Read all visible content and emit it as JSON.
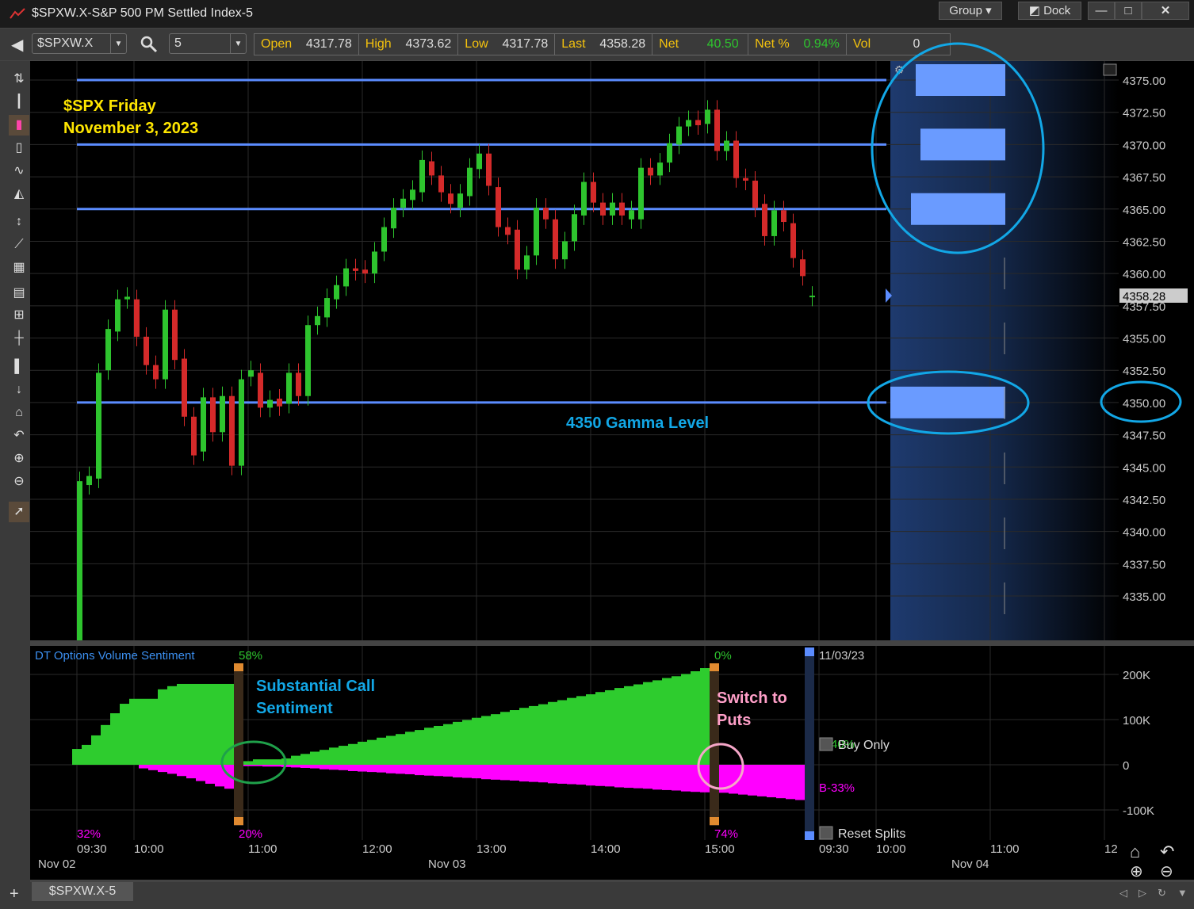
{
  "window": {
    "title": "$SPXW.X-S&P 500 PM Settled Index-5",
    "group_label": "Group",
    "dock_label": "Dock"
  },
  "toolbar": {
    "symbol": "$SPXW.X",
    "interval": "5",
    "stats": [
      {
        "label": "Open",
        "value": "4317.78"
      },
      {
        "label": "High",
        "value": "4373.62"
      },
      {
        "label": "Low",
        "value": "4317.78"
      },
      {
        "label": "Last",
        "value": "4358.28"
      },
      {
        "label": "Net",
        "value": "40.50"
      },
      {
        "label": "Net %",
        "value": "0.94%"
      },
      {
        "label": "Vol",
        "value": "0"
      }
    ]
  },
  "colors": {
    "up": "#2ec42e",
    "down": "#d42a2a",
    "level_line": "#5b8cff",
    "annotation_cyan": "#12a7e6",
    "annotation_yellow": "#ffe600",
    "annotation_pink": "#ff9fc8",
    "calls": "#2ecc2e",
    "puts": "#ff00ff"
  },
  "annotations": {
    "title1": "$SPX Friday",
    "title2": "November 3, 2023",
    "gamma": "4350 Gamma Level",
    "call1": "Substantial Call",
    "call2": "Sentiment",
    "put1": "Switch to",
    "put2": "Puts"
  },
  "chart_data": [
    {
      "type": "candlestick",
      "title": "",
      "price_ticks": [
        "4375.00",
        "4372.50",
        "4370.00",
        "4367.50",
        "4365.00",
        "4362.50",
        "4360.00",
        "4357.50",
        "4355.00",
        "4352.50",
        "4350.00",
        "4347.50",
        "4345.00",
        "4342.50",
        "4340.00",
        "4337.50",
        "4335.00"
      ],
      "ylim": [
        4332.5,
        4376.5
      ],
      "last_price": "4358.28",
      "interval_minutes": 5,
      "start_time": "09:30",
      "levels": [
        4375,
        4370,
        4365,
        4350
      ],
      "candles_open_close": [
        [
          4317.78,
          4343.9
        ],
        [
          4343.6,
          4344.3
        ],
        [
          4344.1,
          4352.3
        ],
        [
          4352.5,
          4355.7
        ],
        [
          4355.5,
          4358.0
        ],
        [
          4358.0,
          4358.2
        ],
        [
          4358.0,
          4355.1
        ],
        [
          4355.1,
          4352.9
        ],
        [
          4352.9,
          4351.8
        ],
        [
          4351.8,
          4357.2
        ],
        [
          4357.2,
          4353.3
        ],
        [
          4353.4,
          4348.9
        ],
        [
          4348.9,
          4345.9
        ],
        [
          4346.2,
          4350.4
        ],
        [
          4350.4,
          4347.7
        ],
        [
          4347.7,
          4350.5
        ],
        [
          4350.5,
          4345.1
        ],
        [
          4345.1,
          4351.8
        ],
        [
          4352.0,
          4352.5
        ],
        [
          4352.3,
          4349.6
        ],
        [
          4349.6,
          4350.2
        ],
        [
          4350.3,
          4349.7
        ],
        [
          4349.9,
          4352.3
        ],
        [
          4352.3,
          4350.5
        ],
        [
          4350.5,
          4356.0
        ],
        [
          4356.0,
          4356.7
        ],
        [
          4356.6,
          4358.1
        ],
        [
          4358.0,
          4359.1
        ],
        [
          4359.0,
          4360.4
        ],
        [
          4360.4,
          4360.2
        ],
        [
          4360.3,
          4360.0
        ],
        [
          4360.0,
          4361.7
        ],
        [
          4361.7,
          4363.6
        ],
        [
          4363.5,
          4365.1
        ],
        [
          4365.1,
          4365.8
        ],
        [
          4365.7,
          4366.5
        ],
        [
          4366.3,
          4368.8
        ],
        [
          4368.7,
          4367.6
        ],
        [
          4367.6,
          4366.3
        ],
        [
          4366.2,
          4365.4
        ],
        [
          4365.1,
          4366.2
        ],
        [
          4366.0,
          4368.2
        ],
        [
          4368.1,
          4369.3
        ],
        [
          4369.3,
          4366.8
        ],
        [
          4366.7,
          4363.6
        ],
        [
          4363.6,
          4363.0
        ],
        [
          4363.4,
          4360.3
        ],
        [
          4360.3,
          4361.4
        ],
        [
          4361.4,
          4365.1
        ],
        [
          4365.1,
          4364.2
        ],
        [
          4364.2,
          4361.1
        ],
        [
          4361.1,
          4362.5
        ],
        [
          4362.5,
          4364.6
        ],
        [
          4364.5,
          4367.1
        ],
        [
          4367.1,
          4365.5
        ],
        [
          4365.5,
          4364.5
        ],
        [
          4364.5,
          4365.5
        ],
        [
          4365.5,
          4364.5
        ],
        [
          4364.2,
          4364.9
        ],
        [
          4364.2,
          4368.2
        ],
        [
          4368.2,
          4367.6
        ],
        [
          4367.6,
          4368.6
        ],
        [
          4368.6,
          4370.1
        ],
        [
          4370.0,
          4371.4
        ],
        [
          4371.4,
          4371.9
        ],
        [
          4371.9,
          4371.5
        ],
        [
          4371.6,
          4372.7
        ],
        [
          4372.7,
          4369.5
        ],
        [
          4369.5,
          4370.3
        ],
        [
          4370.3,
          4367.4
        ],
        [
          4367.4,
          4367.2
        ],
        [
          4367.2,
          4365.1
        ],
        [
          4365.4,
          4362.9
        ],
        [
          4362.9,
          4364.9
        ],
        [
          4364.9,
          4364.0
        ],
        [
          4363.9,
          4361.2
        ],
        [
          4361.1,
          4359.8
        ],
        [
          4358.2,
          4358.28
        ]
      ]
    },
    {
      "type": "bar",
      "title": "DT Options Volume Sentiment",
      "ylim": [
        -170,
        250
      ],
      "y_ticks": [
        "200K",
        "100K",
        "0",
        "-100K"
      ],
      "units": "K",
      "calls": [
        35,
        44,
        65,
        88,
        114,
        135,
        146,
        146,
        146,
        167,
        174,
        179,
        179,
        179,
        179,
        179,
        179,
        5,
        8,
        12,
        12,
        12,
        14,
        20,
        24,
        29,
        33,
        38,
        42,
        46,
        51,
        55,
        60,
        64,
        68,
        73,
        77,
        82,
        86,
        90,
        95,
        99,
        104,
        108,
        112,
        117,
        121,
        126,
        130,
        134,
        139,
        143,
        148,
        152,
        156,
        161,
        165,
        170,
        174,
        178,
        183,
        187,
        192,
        196,
        201,
        207,
        214,
        0,
        0,
        0,
        0,
        0,
        0,
        0,
        0,
        0,
        0,
        0
      ],
      "puts": [
        0,
        0,
        0,
        0,
        0,
        0,
        0,
        -8,
        -12,
        -16,
        -20,
        -25,
        -30,
        -36,
        -42,
        -48,
        -53,
        -53,
        -3,
        -3,
        -4,
        -4,
        -5,
        -6,
        -7,
        -8,
        -10,
        -11,
        -12,
        -14,
        -15,
        -16,
        -17,
        -19,
        -20,
        -21,
        -23,
        -24,
        -25,
        -26,
        -28,
        -29,
        -30,
        -32,
        -33,
        -34,
        -35,
        -37,
        -38,
        -39,
        -41,
        -42,
        -43,
        -44,
        -46,
        -47,
        -48,
        -50,
        -51,
        -52,
        -53,
        -55,
        -56,
        -57,
        -59,
        -60,
        -61,
        -61,
        -62,
        -64,
        -66,
        -68,
        -70,
        -72,
        -74,
        -76,
        -78,
        -80
      ],
      "split_labels": {
        "start_bottom": "32%",
        "s1_top": "58%",
        "s1_bottom": "20%",
        "s2_top": "0%",
        "s2_bottom": "74%"
      },
      "side": {
        "date": "11/03/23",
        "buy_pct": "B-40%",
        "buy_only": "Buy Only",
        "sell_pct": "B-33%",
        "reset": "Reset Splits"
      }
    },
    {
      "x_ticks": [
        "09:30",
        "10:00",
        "11:00",
        "12:00",
        "13:00",
        "14:00",
        "15:00",
        "09:30",
        "10:00",
        "11:00",
        "12"
      ],
      "dates": [
        "Nov 02",
        "Nov 03",
        "Nov 04"
      ]
    }
  ],
  "tabs": [
    {
      "label": "$SPXW.X-5"
    }
  ]
}
